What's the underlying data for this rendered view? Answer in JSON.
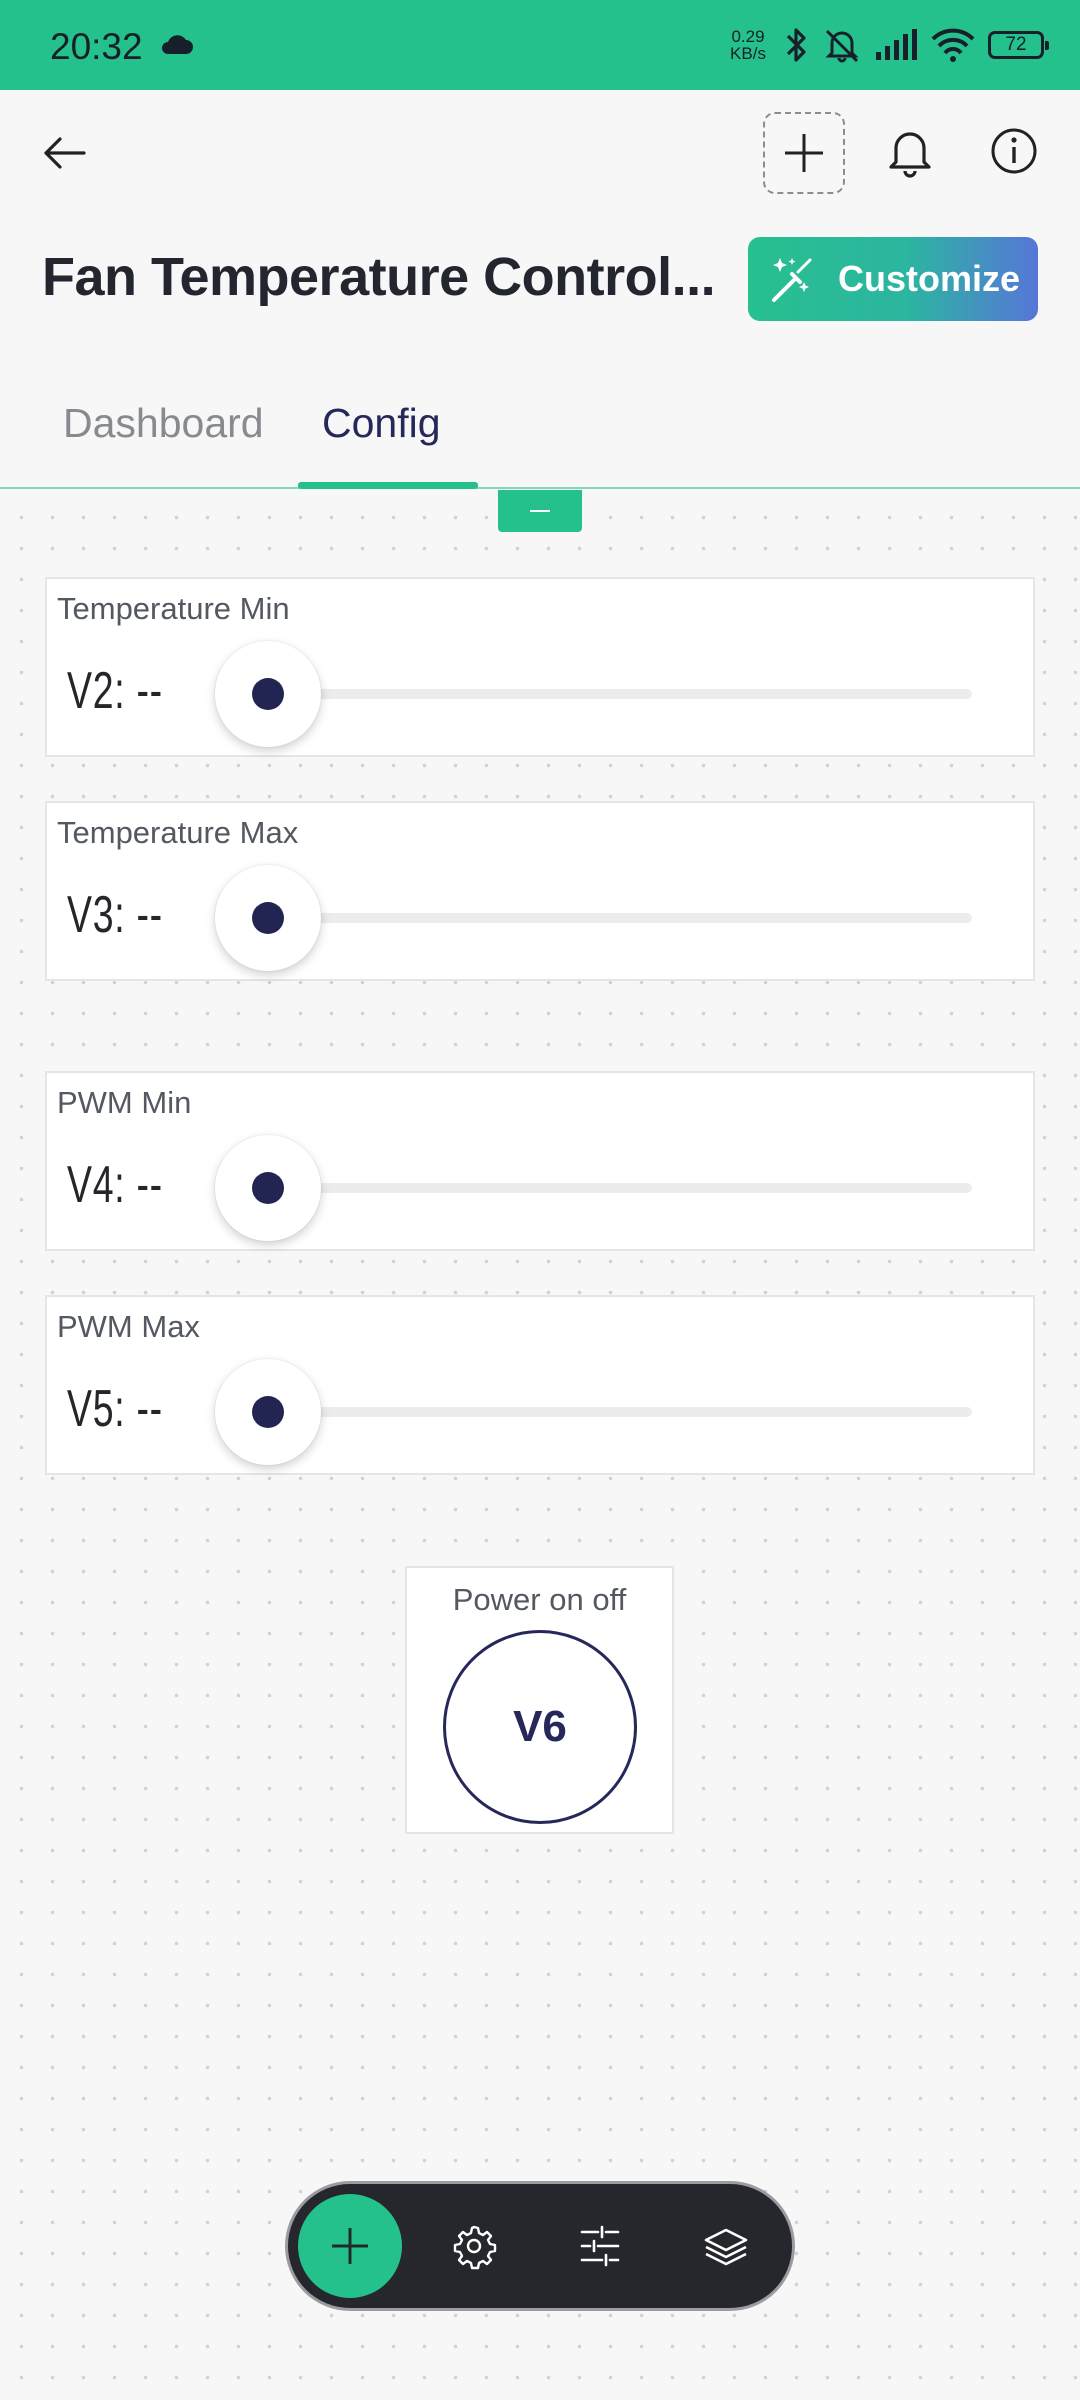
{
  "status_bar": {
    "time": "20:32",
    "net_speed_value": "0.29",
    "net_speed_unit": "KB/s",
    "battery": "72"
  },
  "header": {
    "title": "Fan Temperature Control...",
    "customize_label": "Customize"
  },
  "tabs": [
    {
      "label": "Dashboard",
      "active": false
    },
    {
      "label": "Config",
      "active": true
    }
  ],
  "sliders": [
    {
      "label": "Temperature Min",
      "pin_value": "V2: --",
      "value": 0
    },
    {
      "label": "Temperature Max",
      "pin_value": "V3: --",
      "value": 0
    },
    {
      "label": "PWM Min",
      "pin_value": "V4: --",
      "value": 0
    },
    {
      "label": "PWM Max",
      "pin_value": "V5: --",
      "value": 0
    }
  ],
  "power_button": {
    "label": "Power on off",
    "pin": "V6"
  },
  "toolbar": {
    "icons": [
      "plus-icon",
      "gear-icon",
      "sliders-icon",
      "layers-icon"
    ]
  },
  "colors": {
    "accent": "#25c18c",
    "navy": "#23254f",
    "gradient_end": "#5676d8"
  }
}
